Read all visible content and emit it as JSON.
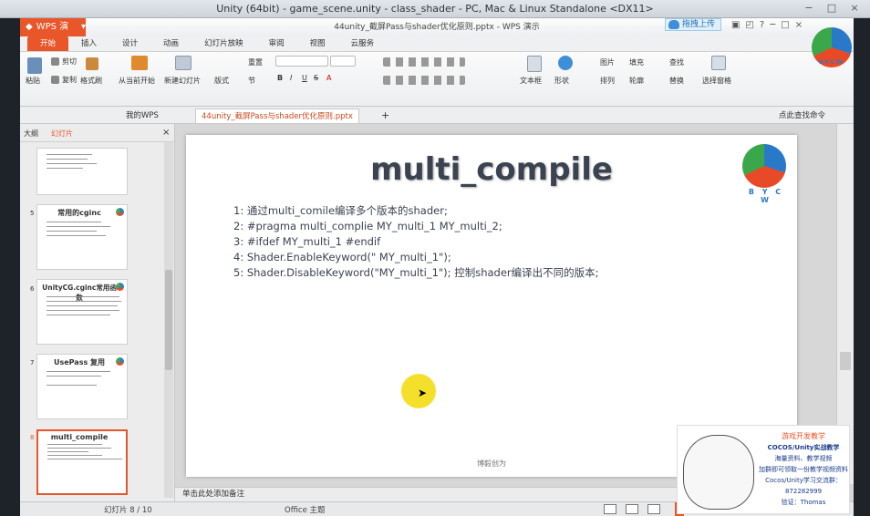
{
  "outer_window": {
    "title": "Unity (64bit) - game_scene.unity - class_shader - PC, Mac & Linux Standalone <DX11>",
    "controls": [
      "−",
      "□",
      "×"
    ]
  },
  "wps": {
    "app_name": "WPS 演示",
    "doc_title": "44unity_截屏Pass与shader优化原则.pptx - WPS 演示",
    "upload_label": "拖拽上传",
    "tray_icons": [
      "▣",
      "◰",
      "?",
      "─",
      "□",
      "×"
    ],
    "ribbon_tabs": [
      "开始",
      "插入",
      "设计",
      "动画",
      "幻灯片放映",
      "审阅",
      "视图",
      "云服务"
    ],
    "ribbon": {
      "paste": "粘贴",
      "cut": "剪切",
      "copy": "复制",
      "format_painter": "格式刷",
      "from_current": "从当前开始",
      "new_slide": "新建幻灯片",
      "layout": "版式",
      "section": "节",
      "reset": "重置",
      "textbox": "文本框",
      "shape": "形状",
      "arrange": "排列",
      "picture": "图片",
      "fill": "填充",
      "outline": "轮廓",
      "find": "查找",
      "replace": "替换",
      "select_pane": "选择窗格",
      "font_buttons": [
        "B",
        "I",
        "U",
        "S",
        "A"
      ]
    },
    "doc_tabs": {
      "mywps": "我的WPS",
      "active": "44unity_截屏Pass与shader优化原则.pptx",
      "search": "点此查找命令"
    },
    "panel_tabs": {
      "outline": "大纲",
      "slides": "幻灯片"
    },
    "thumbnails": [
      {
        "num": "",
        "title": ""
      },
      {
        "num": "5",
        "title": "常用的cginc"
      },
      {
        "num": "6",
        "title": "UnityCG.cginc常用函数"
      },
      {
        "num": "7",
        "title": "UsePass 复用"
      },
      {
        "num": "8",
        "title": "multi_compile"
      }
    ],
    "add_slide": "+",
    "slide": {
      "title": "multi_compile",
      "logo_text": "B Y C W",
      "lines": [
        "1: 通过multi_comile编译多个版本的shader;",
        "2: #pragma multi_complie MY_multi_1  MY_multi_2;",
        "3: #ifdef MY_multi_1 #endif",
        "4: Shader.EnableKeyword(\" MY_multi_1\");",
        "5: Shader.DisableKeyword(\"MY_multi_1\"); 控制shader编译出不同的版本;"
      ],
      "footer": "博毅创为"
    },
    "notes_placeholder": "单击此处添加备注",
    "status": {
      "slide_counter": "幻灯片 8 / 10",
      "theme": "Office 主题"
    }
  },
  "top_logo_text": "BYCW",
  "promo": {
    "line1": "游戏开发教学",
    "line2": "COCOS/Unity实战教学",
    "line3": "海量资料、教学视频",
    "line4": "加群即可领取一份教学视频资料",
    "line5": "Cocos/Unity学习交流群：872282999",
    "line6": "验证：Thomas"
  },
  "colors": {
    "accent": "#e8562a",
    "slide_title": "#3b4250",
    "cursor": "#f3dd13"
  }
}
